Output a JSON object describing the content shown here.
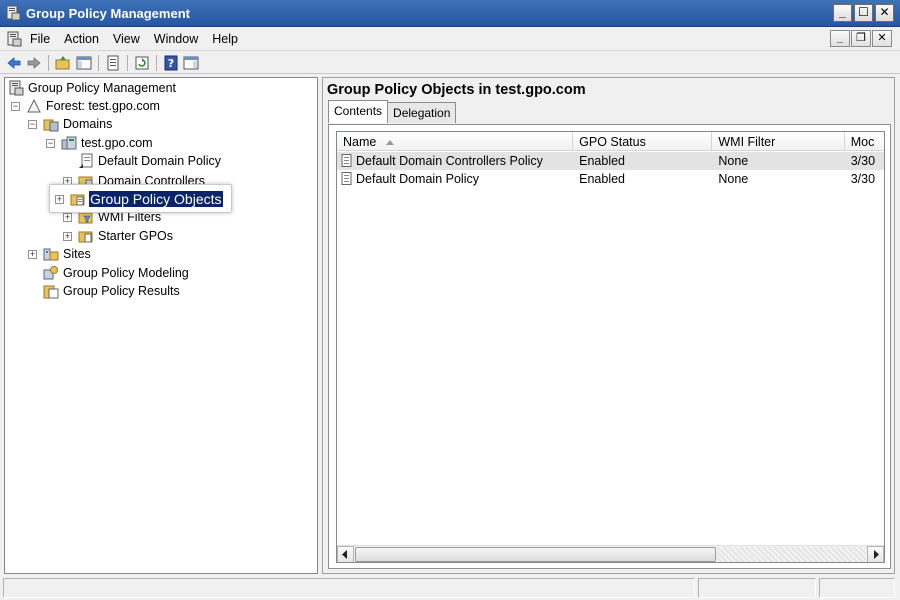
{
  "window": {
    "title": "Group Policy Management"
  },
  "menu": {
    "items": [
      "File",
      "Action",
      "View",
      "Window",
      "Help"
    ]
  },
  "toolbar": {
    "icons": [
      "back-arrow-icon",
      "forward-arrow-icon",
      "up-folder-icon",
      "show-hide-tree-icon",
      "properties-icon",
      "refresh-icon",
      "help-icon",
      "action-pane-icon"
    ]
  },
  "tree": {
    "root": "Group Policy Management",
    "forest": "Forest: test.gpo.com",
    "domains": "Domains",
    "domain": "test.gpo.com",
    "default_domain_policy": "Default Domain Policy",
    "domain_controllers": "Domain Controllers",
    "gpo": "Group Policy Objects",
    "wmi_filters": "WMI Filters",
    "starter_gpos": "Starter GPOs",
    "sites": "Sites",
    "modeling": "Group Policy Modeling",
    "results": "Group Policy Results"
  },
  "right": {
    "title": "Group Policy Objects in test.gpo.com",
    "tabs": [
      "Contents",
      "Delegation"
    ],
    "columns": [
      "Name",
      "GPO Status",
      "WMI Filter",
      "Moc"
    ],
    "rows": [
      {
        "name": "Default Domain Controllers Policy",
        "status": "Enabled",
        "wmi": "None",
        "modified": "3/30"
      },
      {
        "name": "Default Domain Policy",
        "status": "Enabled",
        "wmi": "None",
        "modified": "3/30"
      }
    ]
  },
  "colors": {
    "titlebar": "#2e61ad",
    "selection": "#0a246a"
  }
}
